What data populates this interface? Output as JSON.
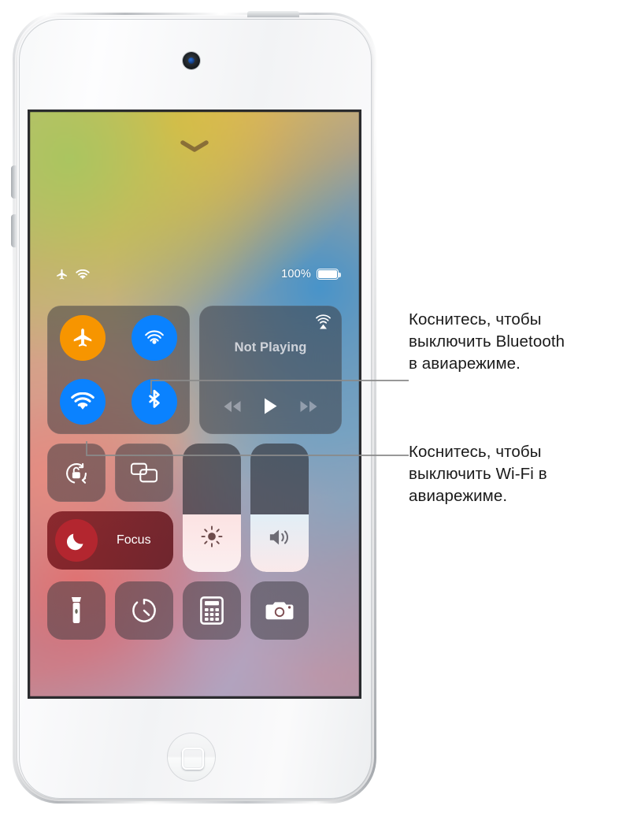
{
  "device": {
    "name": "iPod touch",
    "body_color": "#f5f6f7",
    "hardware": {
      "camera": "front-camera",
      "home_button": "home-button",
      "power_button": "power-button",
      "volume_up": "volume-up-button",
      "volume_down": "volume-down-button"
    }
  },
  "screen": {
    "grabber_icon": "chevron-down-icon",
    "wallpaper": {
      "colors": [
        "#b9bd85",
        "#d8a871",
        "#3e92ce",
        "#e25c60",
        "#9aa4bc"
      ]
    }
  },
  "status_bar": {
    "airplane_icon": "airplane-icon",
    "wifi_icon": "wifi-icon",
    "battery_percent": "100%",
    "battery_icon": "battery-full-icon"
  },
  "control_center": {
    "connectivity": {
      "airplane_mode": {
        "label": "Airplane Mode",
        "icon": "airplane-icon",
        "state": "on",
        "color": "#f79500"
      },
      "airdrop": {
        "label": "AirDrop",
        "icon": "airdrop-icon",
        "state": "on",
        "color": "#0a82ff"
      },
      "wifi": {
        "label": "Wi-Fi",
        "icon": "wifi-icon",
        "state": "on",
        "color": "#0a82ff"
      },
      "bluetooth": {
        "label": "Bluetooth",
        "icon": "bluetooth-icon",
        "state": "on",
        "color": "#0a82ff"
      }
    },
    "media": {
      "title": "Not Playing",
      "airplay_icon": "airplay-icon",
      "rewind_icon": "rewind-icon",
      "play_icon": "play-icon",
      "forward_icon": "fast-forward-icon"
    },
    "rotation_lock": {
      "label": "Rotation Lock",
      "icon": "rotation-lock-icon",
      "state": "off"
    },
    "screen_mirroring": {
      "label": "Screen Mirroring",
      "icon": "screen-mirroring-icon"
    },
    "focus": {
      "label": "Focus",
      "icon": "moon-icon",
      "accent": "#b3262f"
    },
    "brightness": {
      "label": "Brightness",
      "icon": "brightness-icon",
      "value_percent": 45
    },
    "volume": {
      "label": "Volume",
      "icon": "speaker-icon",
      "value_percent": 45
    },
    "apps": [
      {
        "label": "Flashlight",
        "icon": "flashlight-icon"
      },
      {
        "label": "Timer",
        "icon": "timer-icon"
      },
      {
        "label": "Calculator",
        "icon": "calculator-icon"
      },
      {
        "label": "Camera",
        "icon": "camera-icon"
      }
    ]
  },
  "callouts": {
    "bluetooth": {
      "line1": "Коснитесь, чтобы",
      "line2": "выключить Bluetooth",
      "line3": "в авиарежиме."
    },
    "wifi": {
      "line1": "Коснитесь, чтобы",
      "line2": "выключить Wi-Fi в",
      "line3": "авиарежиме."
    },
    "line_color": "#8a8a8a"
  }
}
